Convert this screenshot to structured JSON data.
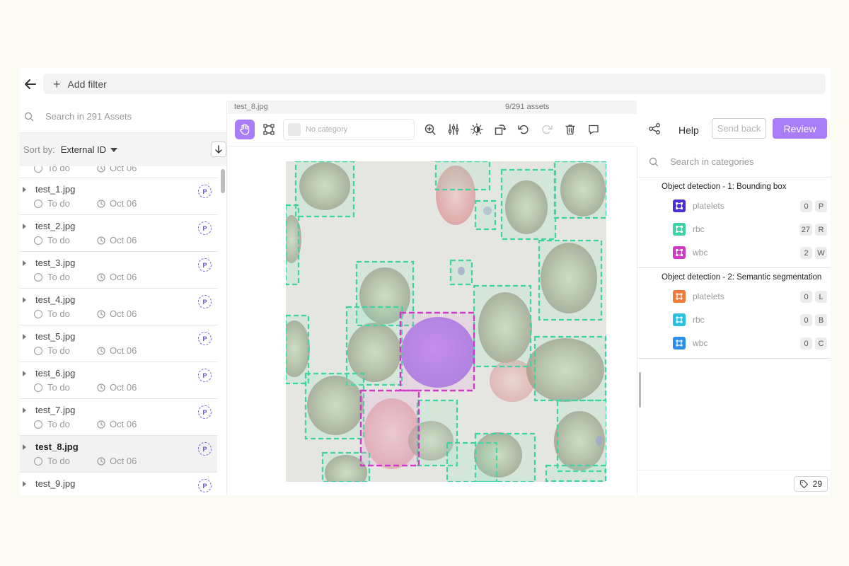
{
  "topbar": {
    "add_filter_label": "Add filter"
  },
  "left_panel": {
    "search_placeholder": "Search in 291 Assets",
    "sort_label": "Sort by:",
    "sort_value": "External ID",
    "assets": [
      {
        "name": "",
        "status": "To do",
        "date": "Oct 06",
        "priority": "",
        "partial": true
      },
      {
        "name": "test_1.jpg",
        "status": "To do",
        "date": "Oct 06",
        "priority": "P"
      },
      {
        "name": "test_2.jpg",
        "status": "To do",
        "date": "Oct 06",
        "priority": "P"
      },
      {
        "name": "test_3.jpg",
        "status": "To do",
        "date": "Oct 06",
        "priority": "P"
      },
      {
        "name": "test_4.jpg",
        "status": "To do",
        "date": "Oct 06",
        "priority": "P"
      },
      {
        "name": "test_5.jpg",
        "status": "To do",
        "date": "Oct 06",
        "priority": "P"
      },
      {
        "name": "test_6.jpg",
        "status": "To do",
        "date": "Oct 06",
        "priority": "P"
      },
      {
        "name": "test_7.jpg",
        "status": "To do",
        "date": "Oct 06",
        "priority": "P"
      },
      {
        "name": "test_8.jpg",
        "status": "To do",
        "date": "Oct 06",
        "priority": "P",
        "selected": true
      },
      {
        "name": "test_9.jpg",
        "status": "",
        "date": "",
        "priority": "P"
      }
    ]
  },
  "viewer": {
    "file_name": "test_8.jpg",
    "asset_counter": "9/291 assets",
    "category_placeholder": "No category"
  },
  "right_panel": {
    "help_label": "Help",
    "send_back_label": "Send back",
    "review_label": "Review",
    "category_search_placeholder": "Search in categories",
    "jobs": [
      {
        "title": "Object detection - 1: Bounding box",
        "categories": [
          {
            "name": "platelets",
            "count": "0",
            "key": "P",
            "color": "#4b2fd0",
            "icon": "bbox-icon"
          },
          {
            "name": "rbc",
            "count": "27",
            "key": "R",
            "color": "#3ed3a0",
            "icon": "bbox-icon"
          },
          {
            "name": "wbc",
            "count": "2",
            "key": "W",
            "color": "#d038c8",
            "icon": "bbox-icon"
          }
        ]
      },
      {
        "title": "Object detection - 2: Semantic segmentation",
        "categories": [
          {
            "name": "platelets",
            "count": "0",
            "key": "L",
            "color": "#f07a3c",
            "icon": "polygon-icon"
          },
          {
            "name": "rbc",
            "count": "0",
            "key": "B",
            "color": "#2cc0e0",
            "icon": "polygon-icon"
          },
          {
            "name": "wbc",
            "count": "0",
            "key": "C",
            "color": "#2b8ee8",
            "icon": "polygon-icon"
          }
        ]
      }
    ],
    "object_count": "29"
  },
  "colors": {
    "accent": "#a87df7",
    "rbc_box": "#3ed3a0",
    "wbc_box": "#d038c8"
  }
}
